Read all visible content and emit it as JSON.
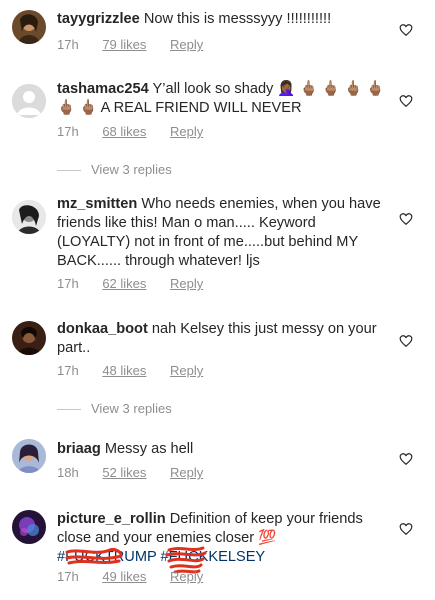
{
  "comments": [
    {
      "username": "tayygrizzlee",
      "text": "Now this is messsyyy !!!!!!!!!!!",
      "time": "17h",
      "likes": "79 likes",
      "reply": "Reply"
    },
    {
      "username": "tashamac254",
      "text": "Y’all look so shady 🤦🏾‍♀️ 🖕🏽 🖕🏽 🖕🏽 🖕🏽 🖕🏽 🖕🏽 A REAL FRIEND WILL NEVER",
      "time": "17h",
      "likes": "68 likes",
      "reply": "Reply",
      "view_replies": "View 3 replies"
    },
    {
      "username": "mz_smitten",
      "text": "Who needs enemies, when you have friends like this! Man o man..... Keyword (LOYALTY) not in front of me.....but behind MY BACK...... through whatever! ljs",
      "time": "17h",
      "likes": "62 likes",
      "reply": "Reply"
    },
    {
      "username": "donkaa_boot",
      "text": "nah Kelsey this just messy on your part..",
      "time": "17h",
      "likes": "48 likes",
      "reply": "Reply",
      "view_replies": "View 3 replies"
    },
    {
      "username": "briaag",
      "text": "Messy as hell",
      "time": "18h",
      "likes": "52 likes",
      "reply": "Reply"
    },
    {
      "username": "picture_e_rollin",
      "text": "Definition of keep your friends close and your enemies closer 💯",
      "hashtag1": "#FUCKTRUMP",
      "hashtag2": "#FUCKKELSEY",
      "time": "17h",
      "likes": "49 likes",
      "reply": "Reply"
    }
  ],
  "icons": {
    "heart": "heart-outline-icon"
  },
  "colors": {
    "text": "#262626",
    "meta": "#8e8e8e",
    "hashtag": "#003569",
    "scribble": "#e0301e"
  }
}
